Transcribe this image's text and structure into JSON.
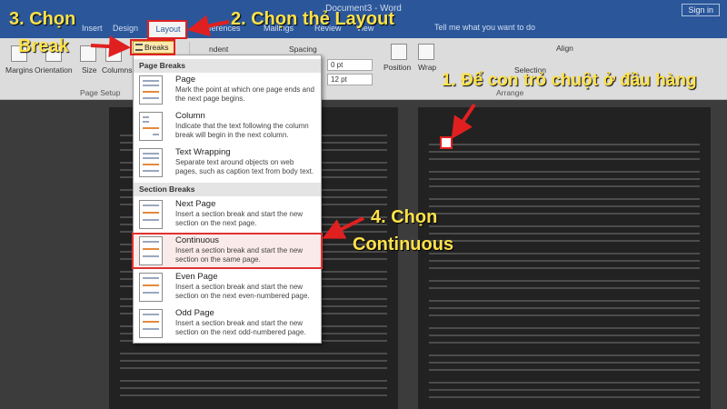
{
  "window": {
    "title": "Document3 - Word",
    "signin": "Sign in"
  },
  "tabs": {
    "insert": "Insert",
    "design": "Design",
    "layout": "Layout",
    "references": "ferences",
    "mailings": "Mailings",
    "review": "Review",
    "view": "View",
    "tellme": "Tell me what you want to do"
  },
  "ribbon": {
    "margins": "Margins",
    "orientation": "Orientation",
    "size": "Size",
    "columns": "Columns",
    "breaks": "Breaks",
    "page_setup": "Page Setup",
    "indent": "ndent",
    "spacing": "Spacing",
    "before_value": "0 pt",
    "after_value": "12 pt",
    "position": "Position",
    "wrap": "Wrap",
    "selection": "Selection",
    "align": "Align",
    "arrange": "Arrange"
  },
  "breaks_menu": {
    "page_breaks_header": "Page Breaks",
    "section_breaks_header": "Section Breaks",
    "items": [
      {
        "title": "Page",
        "desc": "Mark the point at which one page ends and the next page begins."
      },
      {
        "title": "Column",
        "desc": "Indicate that the text following the column break will begin in the next column."
      },
      {
        "title": "Text Wrapping",
        "desc": "Separate text around objects on web pages, such as caption text from body text."
      },
      {
        "title": "Next Page",
        "desc": "Insert a section break and start the new section on the next page."
      },
      {
        "title": "Continuous",
        "desc": "Insert a section break and start the new section on the same page."
      },
      {
        "title": "Even Page",
        "desc": "Insert a section break and start the new section on the next even-numbered page."
      },
      {
        "title": "Odd Page",
        "desc": "Insert a section break and start the new section on the next odd-numbered page."
      }
    ]
  },
  "annotations": {
    "step1": "1. Để con trỏ chuột ở đầu hàng",
    "step2": "2. Chọn thẻ Layout",
    "step3_line1": "3. Chọn",
    "step3_line2": "Break",
    "step4_line1": "4. Chọn",
    "step4_line2": "Continuous"
  },
  "colors": {
    "annotation_text": "#ffe24a",
    "highlight_box": "#e02020",
    "word_blue": "#2b579a"
  }
}
